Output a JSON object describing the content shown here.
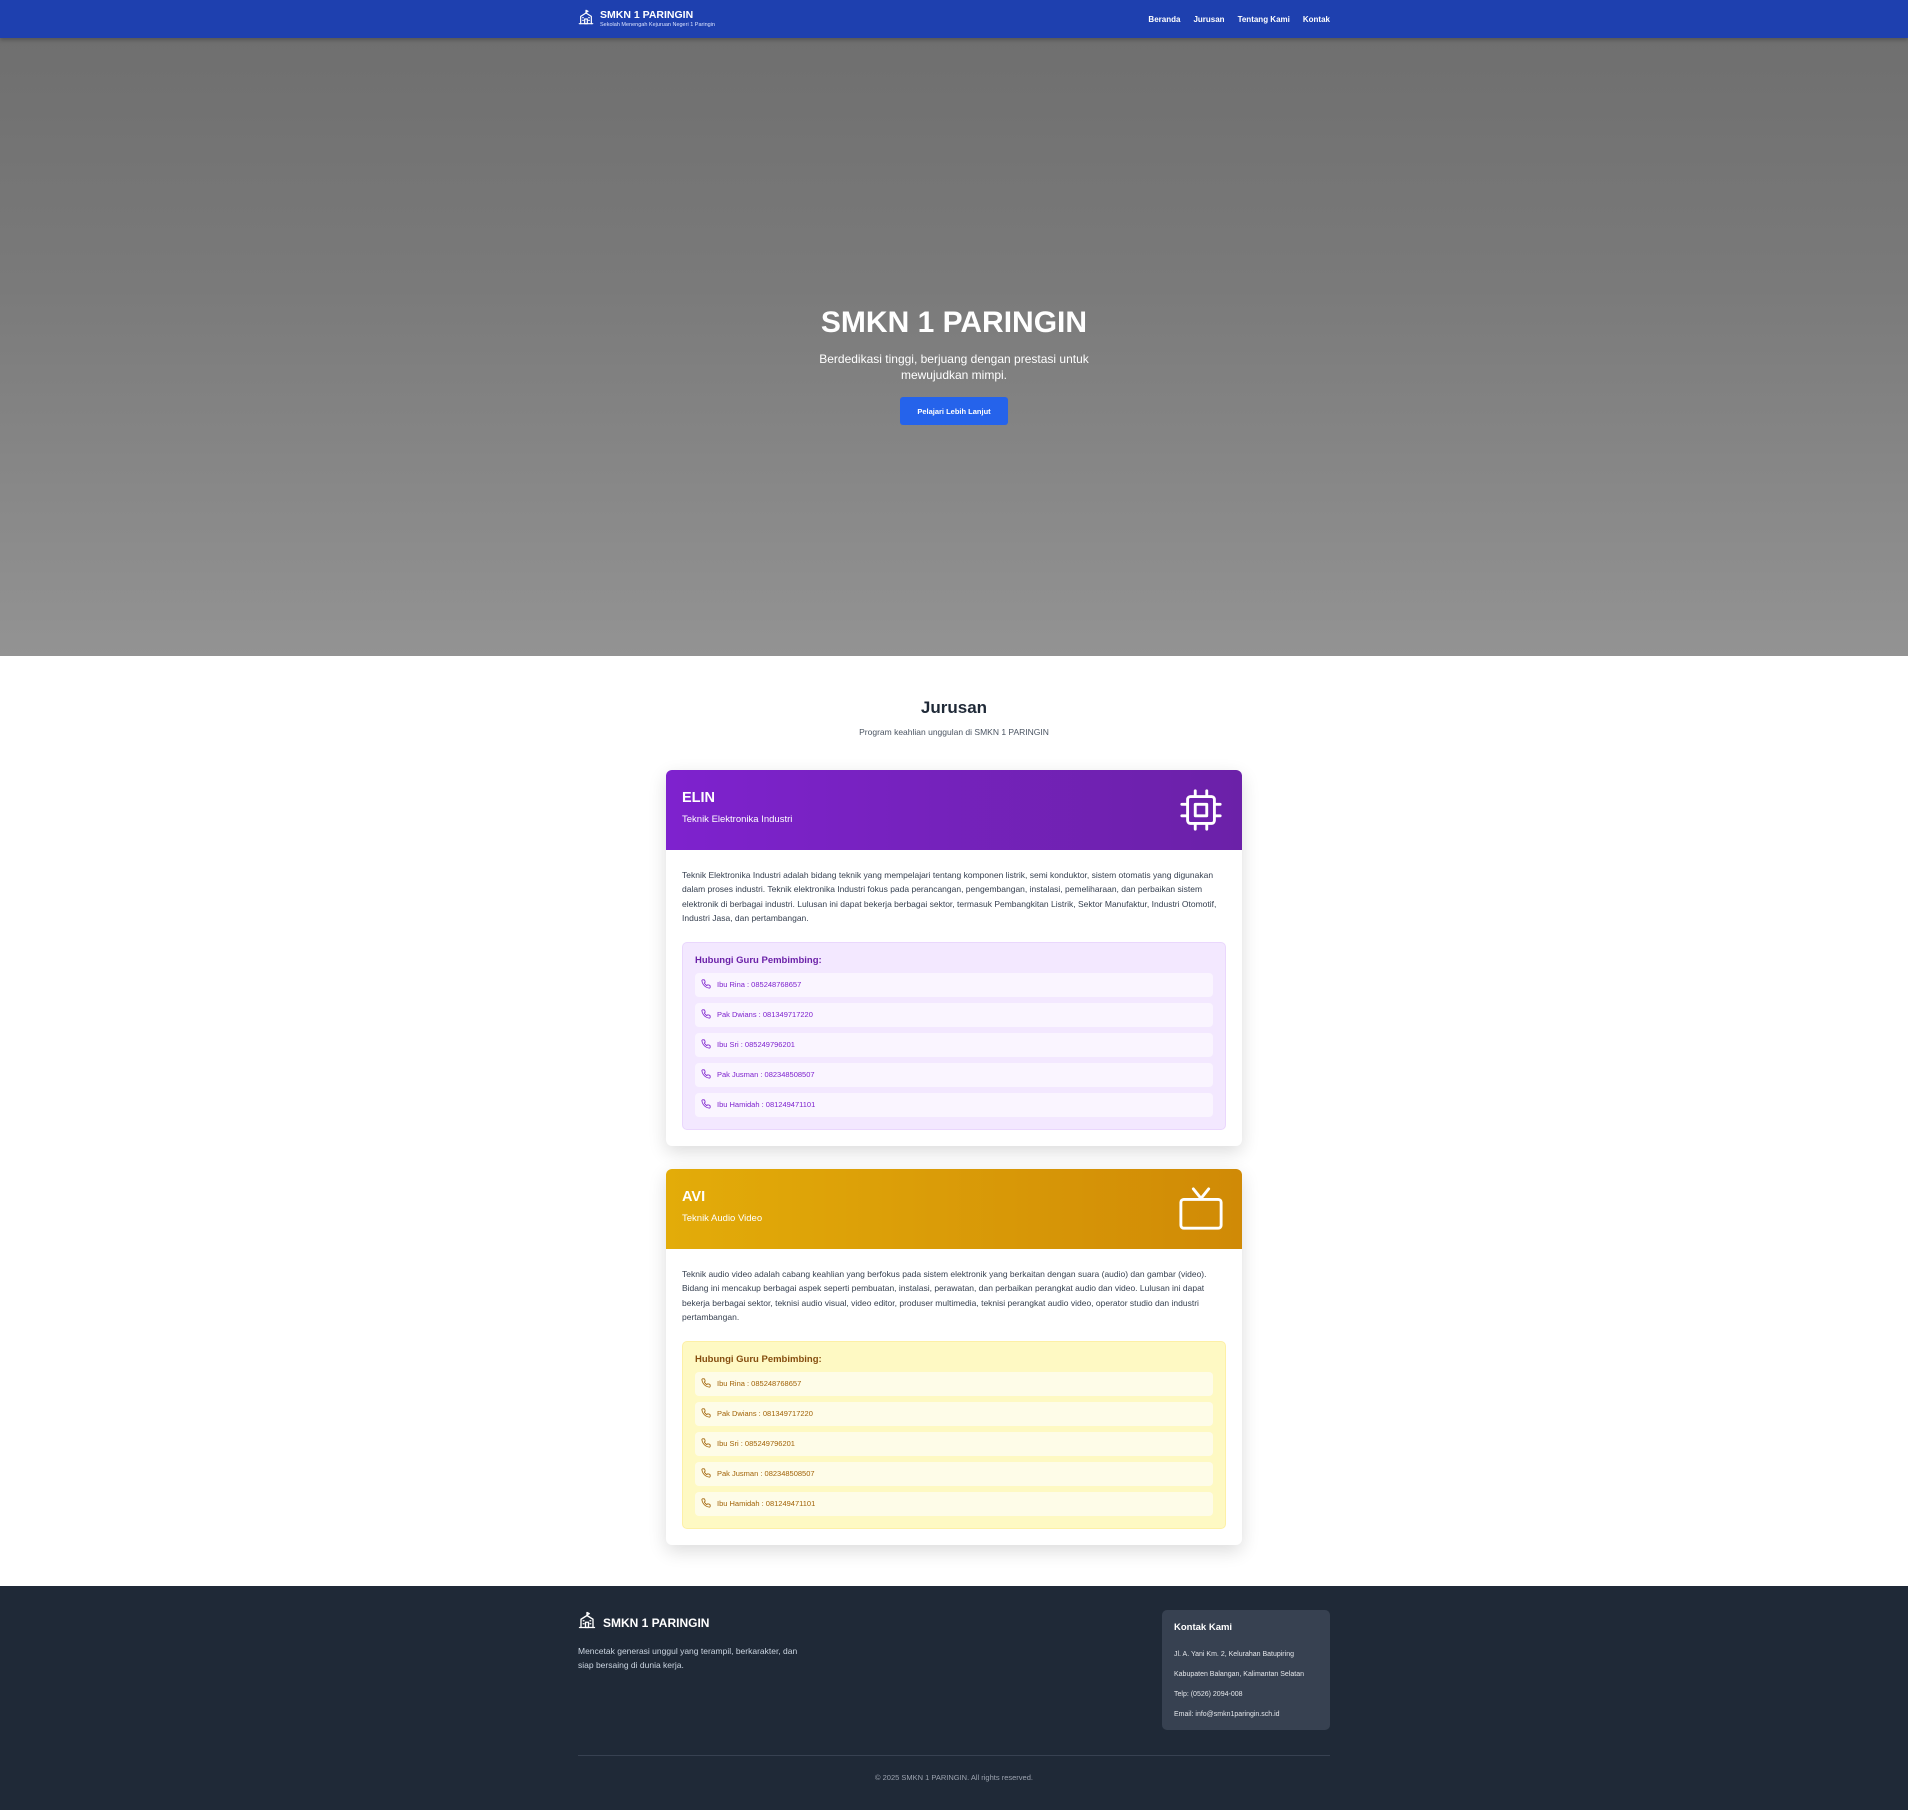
{
  "navbar": {
    "brand_title": "SMKN 1 PARINGIN",
    "brand_subtitle": "Sekolah Menengah Kejuruan Negeri 1 Paringin",
    "logo_icon": "school-icon",
    "links": [
      "Beranda",
      "Jurusan",
      "Tentang Kami",
      "Kontak"
    ],
    "bg_color": "#1e40af"
  },
  "hero": {
    "title": "SMKN 1 PARINGIN",
    "subtitle": "Berdedikasi tinggi, berjuang dengan prestasi untuk mewujudkan mimpi.",
    "button_label": "Pelajari Lebih Lanjut",
    "button_color": "#2563eb"
  },
  "jurusan": {
    "title": "Jurusan",
    "subtitle": "Program keahlian unggulan di SMKN 1 PARINGIN",
    "cards": [
      {
        "code": "ELIN",
        "name": "Teknik Elektronika Industri",
        "icon": "chip-icon",
        "accent": "#7e22ce",
        "description": "Teknik Elektronika Industri adalah bidang teknik yang mempelajari tentang komponen listrik, semi konduktor, sistem otomatis yang digunakan dalam proses industri. Teknik elektronika Industri fokus pada perancangan, pengembangan, instalasi, pemeliharaan, dan perbaikan sistem elektronik di berbagai industri. Lulusan ini dapat bekerja berbagai sektor, termasuk Pembangkitan Listrik, Sektor Manufaktur, Industri Otomotif, Industri Jasa, dan pertambangan.",
        "contact_title": "Hubungi Guru Pembimbing:",
        "contacts": [
          "Ibu Rina : 085248768657",
          "Pak Dwians : 081349717220",
          "Ibu Sri : 085249796201",
          "Pak Jusman : 082348508507",
          "Ibu Hamidah : 081249471101"
        ]
      },
      {
        "code": "AVI",
        "name": "Teknik Audio Video",
        "icon": "tv-icon",
        "accent": "#e3ac09",
        "description": "Teknik audio video adalah cabang keahlian yang berfokus pada sistem elektronik yang berkaitan dengan suara (audio) dan gambar (video). Bidang ini mencakup berbagai aspek seperti pembuatan, instalasi, perawatan, dan perbaikan perangkat audio dan video. Lulusan ini dapat bekerja berbagai sektor, teknisi audio visual, video editor, produser multimedia, teknisi perangkat audio video, operator studio dan industri pertambangan.",
        "contact_title": "Hubungi Guru Pembimbing:",
        "contacts": [
          "Ibu Rina : 085248768657",
          "Pak Dwians : 081349717220",
          "Ibu Sri : 085249796201",
          "Pak Jusman : 082348508507",
          "Ibu Hamidah : 081249471101"
        ]
      }
    ]
  },
  "footer": {
    "brand_title": "SMKN 1 PARINGIN",
    "description": "Mencetak generasi unggul yang terampil, berkarakter, dan siap bersaing di dunia kerja.",
    "contact_title": "Kontak Kami",
    "contact_lines": [
      "Jl. A. Yani Km. 2, Kelurahan Batupiring",
      "Kabupaten Balangan, Kalimantan Selatan",
      "Telp: (0526) 2094-008",
      "Email: info@smkn1paringin.sch.id"
    ],
    "copyright": "© 2025 SMKN 1 PARINGIN. All rights reserved.",
    "bg_color": "#1f2937"
  }
}
